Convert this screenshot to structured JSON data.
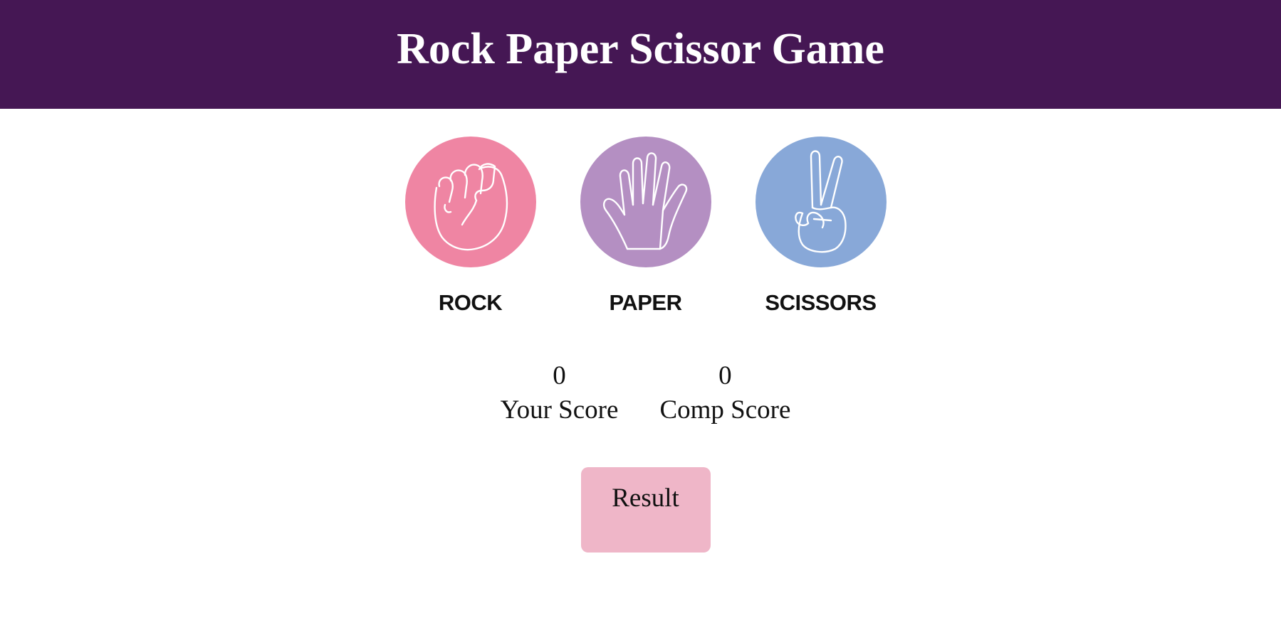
{
  "header": {
    "title": "Rock Paper Scissor Game",
    "background": "#451754"
  },
  "choices": [
    {
      "id": "rock",
      "label": "ROCK",
      "icon": "fist-icon",
      "color": "#ef85a3"
    },
    {
      "id": "paper",
      "label": "PAPER",
      "icon": "open-hand-icon",
      "color": "#b48fc2"
    },
    {
      "id": "scissors",
      "label": "SCISSORS",
      "icon": "peace-hand-icon",
      "color": "#88a8d8"
    }
  ],
  "scores": {
    "user": {
      "value": "0",
      "label": "Your Score"
    },
    "comp": {
      "value": "0",
      "label": "Comp Score"
    }
  },
  "result": {
    "text": "Result",
    "background": "#efb6c8"
  }
}
